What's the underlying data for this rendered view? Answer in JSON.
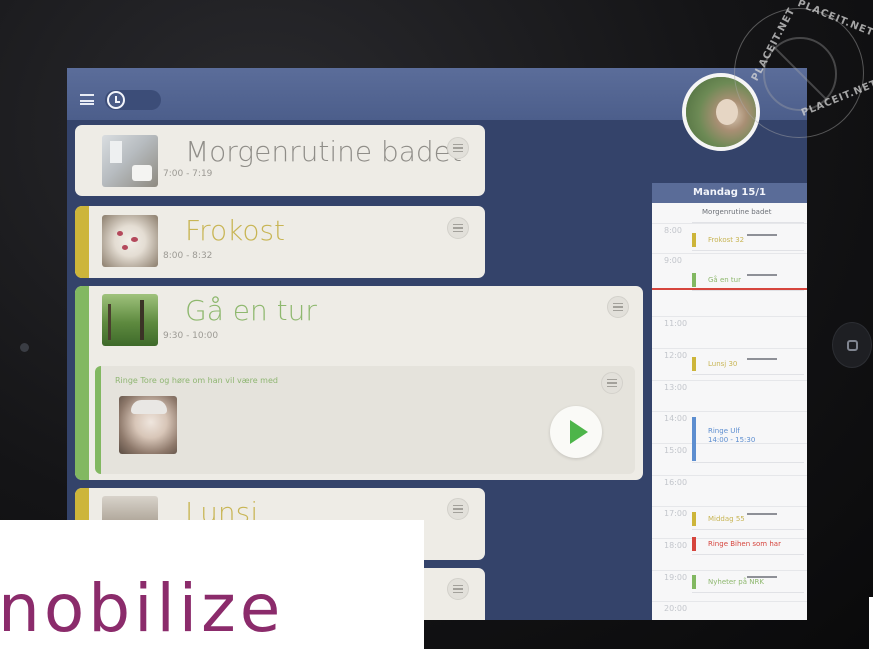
{
  "watermark": {
    "top": "PLACEIT.NET",
    "left": "PLACEIT.NET",
    "right": "PLACEIT.NET"
  },
  "activities": [
    {
      "title": "Morgenrutine badet",
      "time": "7:00 - 7:19",
      "stripe_color": "",
      "title_color": "#8f8d88"
    },
    {
      "title": "Frokost",
      "time": "8:00 - 8:32",
      "stripe_color": "#cdb53a",
      "title_color": "#c8b554"
    },
    {
      "title": "Gå en tur",
      "time": "9:30 - 10:00",
      "stripe_color": "#82b861",
      "title_color": "#8eb86e",
      "sub_note": "Ringe Tore og høre om han vil være med"
    },
    {
      "title": "Lunsj",
      "time": "",
      "stripe_color": "#cdb53a",
      "title_color": "#c8b554"
    }
  ],
  "calendar": {
    "header": "Mandag 15/1",
    "hours": [
      "8:00",
      "9:00",
      "11:00",
      "12:00",
      "13:00",
      "14:00",
      "15:00",
      "16:00",
      "17:00",
      "18:00",
      "19:00",
      "20:00"
    ],
    "events": [
      {
        "label": "Morgenrutine badet",
        "color": "#9aa0a8",
        "text_color": "#6d7178"
      },
      {
        "label": "Frokost 32",
        "color": "#cdb53a",
        "text_color": "#c8b554"
      },
      {
        "label": "Gå en tur",
        "color": "#82b861",
        "text_color": "#8eb86e"
      },
      {
        "label": "Lunsj 30",
        "color": "#cdb53a",
        "text_color": "#c8b554"
      },
      {
        "label": "Ringe Ulf",
        "label2": "14:00 - 15:30",
        "color": "#5d8ed0",
        "text_color": "#5d8ed0"
      },
      {
        "label": "Middag 55",
        "color": "#cdb53a",
        "text_color": "#c8b554"
      },
      {
        "label": "Ringe Bihen som har",
        "color": "#d6453d",
        "text_color": "#d6453d"
      },
      {
        "label": "Nyheter på NRK",
        "color": "#82b861",
        "text_color": "#8eb86e"
      }
    ]
  },
  "logo": {
    "text": "nobilize"
  }
}
